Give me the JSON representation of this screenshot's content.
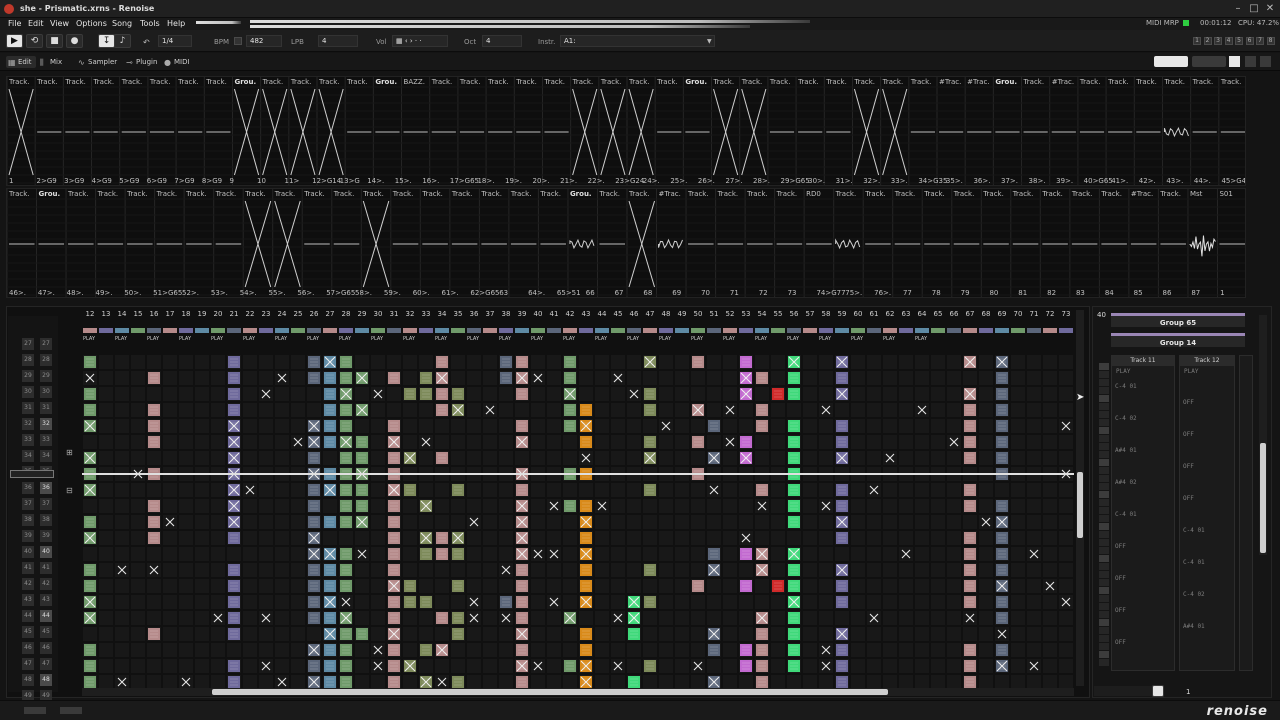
{
  "window": {
    "title": "she - Prismatic.xrns - Renoise",
    "minimize": "–",
    "maximize": "□",
    "close": "✕"
  },
  "menu": [
    "File",
    "Edit",
    "View",
    "Options",
    "Song",
    "Tools",
    "Help"
  ],
  "status": {
    "midi": "MIDI MRP",
    "time": "00:01:12",
    "cpu": "CPU: 47.2%"
  },
  "transport": {
    "lines_per_step": "1/4",
    "bpm_label": "BPM",
    "bpm_value": "482",
    "lpb_label": "LPB",
    "lpb_value": "4",
    "vol_label": "Vol",
    "oct_label": "Oct",
    "oct_value": "4",
    "instr_label": "Instr.",
    "instr_value": "A1:",
    "slot_buttons": [
      "1",
      "2",
      "3",
      "4",
      "5",
      "6",
      "7",
      "8"
    ]
  },
  "tabs": [
    {
      "label": "Edit",
      "icon": "grid-icon",
      "active": true
    },
    {
      "label": "Mix",
      "icon": "mixer-icon",
      "active": false
    },
    {
      "label": "Sampler",
      "icon": "wave-icon",
      "active": false
    },
    {
      "label": "Plugin",
      "icon": "plug-icon",
      "active": false
    },
    {
      "label": "MIDI",
      "icon": "midi-icon",
      "active": false
    }
  ],
  "scope_top": {
    "headers": [
      "Track.",
      "Track.",
      "Track.",
      "Track.",
      "Track.",
      "Track.",
      "Track.",
      "Track.",
      "Grou.",
      "Track.",
      "Track.",
      "Track.",
      "Track.",
      "Grou.",
      "BAZZ.",
      "Track.",
      "Track.",
      "Track.",
      "Track.",
      "Track.",
      "Track.",
      "Track.",
      "Track.",
      "Track.",
      "Grou.",
      "Track.",
      "Track.",
      "Track.",
      "Track.",
      "Track.",
      "Track.",
      "Track.",
      "Track.",
      "#Trac.",
      "#Trac.",
      "Grou.",
      "Track.",
      "#Trac.",
      "Track.",
      "Track.",
      "Track.",
      "Track.",
      "Track.",
      "Track."
    ],
    "footers": [
      "1",
      "2>G9",
      "3>G9",
      "4>G9",
      "5>G9",
      "6>G9",
      "7>G9",
      "8>G9",
      "9",
      "10",
      "11>",
      "12>G14",
      "13>G",
      "14>.",
      "15>.",
      "16>.",
      "17>G65",
      "18>.",
      "19>.",
      "20>.",
      "21>.",
      "22>.",
      "23>G24",
      "24>.",
      "25>.",
      "26>.",
      "27>.",
      "28>.",
      "29>G65",
      "30>.",
      "31>.",
      "32>.",
      "33>.",
      "34>G35",
      "35>.",
      "36>.",
      "37>.",
      "38>.",
      "39>.",
      "40>G65",
      "41>.",
      "42>.",
      "43>.",
      "44>.",
      "45>G47"
    ]
  },
  "scope_bottom": {
    "headers": [
      "Track.",
      "Grou.",
      "Track.",
      "Track.",
      "Track.",
      "Track.",
      "Track.",
      "Track.",
      "Track.",
      "Track.",
      "Track.",
      "Track.",
      "Track.",
      "Track.",
      "Track.",
      "Track.",
      "Track.",
      "Track.",
      "Track.",
      "Grou.",
      "Track.",
      "Track.",
      "#Trac.",
      "Track.",
      "Track.",
      "Track.",
      "Track.",
      "RD0",
      "Track.",
      "Track.",
      "Track.",
      "Track.",
      "Track.",
      "Track.",
      "Track.",
      "Track.",
      "Track.",
      "Track.",
      "#Trac.",
      "Track.",
      "Mst",
      "S01"
    ],
    "footers": [
      "46>.",
      "47>.",
      "48>.",
      "49>.",
      "50>.",
      "51>G65",
      "52>.",
      "53>.",
      "54>.",
      "55>.",
      "56>.",
      "57>G65",
      "58>.",
      "59>.",
      "60>.",
      "61>.",
      "62>G65",
      "63",
      "64>.",
      "65>51",
      "66",
      "67",
      "68",
      "69",
      "70",
      "71",
      "72",
      "73",
      "74>G77",
      "75>.",
      "76>.",
      "77",
      "78",
      "79",
      "80",
      "81",
      "82",
      "83",
      "84",
      "85",
      "86",
      "87",
      "1"
    ]
  },
  "pattern": {
    "columns": [
      "12",
      "13",
      "14",
      "15",
      "16",
      "17",
      "18",
      "19",
      "20",
      "21",
      "22",
      "23",
      "24",
      "25",
      "26",
      "27",
      "28",
      "29",
      "30",
      "31",
      "32",
      "33",
      "34",
      "35",
      "36",
      "37",
      "38",
      "39",
      "40",
      "41",
      "42",
      "43",
      "44",
      "45",
      "46",
      "47",
      "48",
      "49",
      "50",
      "51",
      "52",
      "53",
      "54",
      "55",
      "56",
      "57",
      "58",
      "59",
      "60",
      "61",
      "62",
      "63",
      "64",
      "65",
      "66",
      "67",
      "68",
      "69",
      "70",
      "71",
      "72",
      "73"
    ],
    "rows": [
      "27",
      "28",
      "29",
      "30",
      "31",
      "32",
      "33",
      "34",
      "35",
      "36",
      "37",
      "38",
      "39",
      "40",
      "41",
      "42",
      "43",
      "44",
      "45",
      "46",
      "47",
      "48",
      "49"
    ],
    "play_label": "PLAY"
  },
  "colors": {
    "pink": "#b58a8a",
    "purple": "#6f6a9c",
    "teal": "#5e8aa4",
    "green": "#6f9a6a",
    "orange": "#d98a1a",
    "bright_green": "#3fd97a",
    "red": "#d02a2a",
    "magenta": "#c26ad0",
    "olive": "#7d8a5a",
    "slate": "#5b667a"
  },
  "right_panel": {
    "col_number": "40",
    "group1": "Group 65",
    "group2": "Group 14",
    "track1": "Track 11",
    "track2": "Track 12",
    "play": "PLAY",
    "notes": [
      "C-4 01",
      "OFF",
      "C-4 02",
      "OFF",
      "A#4 01",
      "OFF",
      "A#4 02",
      "OFF",
      "C-4 01",
      "C-4 01",
      "OFF",
      "C-4 01",
      "OFF",
      "C-4 02",
      "OFF",
      "A#4 01",
      "OFF"
    ]
  },
  "footer": {
    "logo": "renoise",
    "page": "1"
  }
}
